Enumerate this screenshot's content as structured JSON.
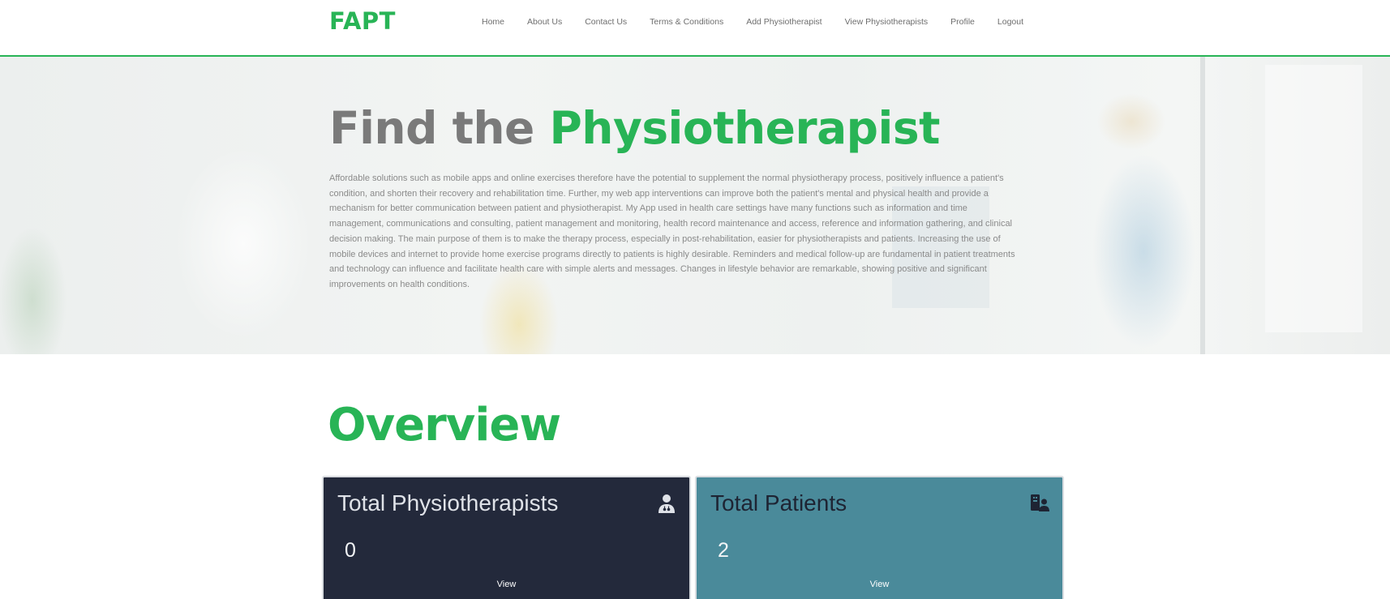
{
  "brand": "FAPT",
  "nav": {
    "items": [
      "Home",
      "About Us",
      "Contact Us",
      "Terms & Conditions",
      "Add Physiotherapist",
      "View Physiotherapists",
      "Profile",
      "Logout"
    ]
  },
  "hero": {
    "title_part1": "Find the ",
    "title_part2": "Physiotherapist",
    "text": "Affordable solutions such as mobile apps and online exercises therefore have the potential to supplement the normal physiotherapy process, positively influence a patient's condition, and shorten their recovery and rehabilitation time. Further, my web app interventions can improve both the patient's mental and physical health and provide a mechanism for better communication between patient and physiotherapist. My App used in health care settings have many functions such as information and time management, communications and consulting, patient management and monitoring, health record maintenance and access, reference and information gathering, and clinical decision making. The main purpose of them is to make the therapy process, especially in post-rehabilitation, easier for physiotherapists and patients. Increasing the use of mobile devices and internet to provide home exercise programs directly to patients is highly desirable. Reminders and medical follow-up are fundamental in patient treatments and technology can influence and facilitate health care with simple alerts and messages. Changes in lifestyle behavior are remarkable, showing positive and significant improvements on health conditions."
  },
  "overview": {
    "title": "Overview",
    "cards": [
      {
        "title": "Total Physiotherapists",
        "count": "0",
        "link": "View",
        "icon": "user-doctor-icon",
        "color": "#23293b"
      },
      {
        "title": "Total Patients",
        "count": "2",
        "link": "View",
        "icon": "hospital-user-icon",
        "color": "#4a8a9a"
      }
    ]
  },
  "colors": {
    "accent": "#28b456",
    "nav_text": "#6e6e6e",
    "hero_title_gray": "#7a7a7a"
  }
}
